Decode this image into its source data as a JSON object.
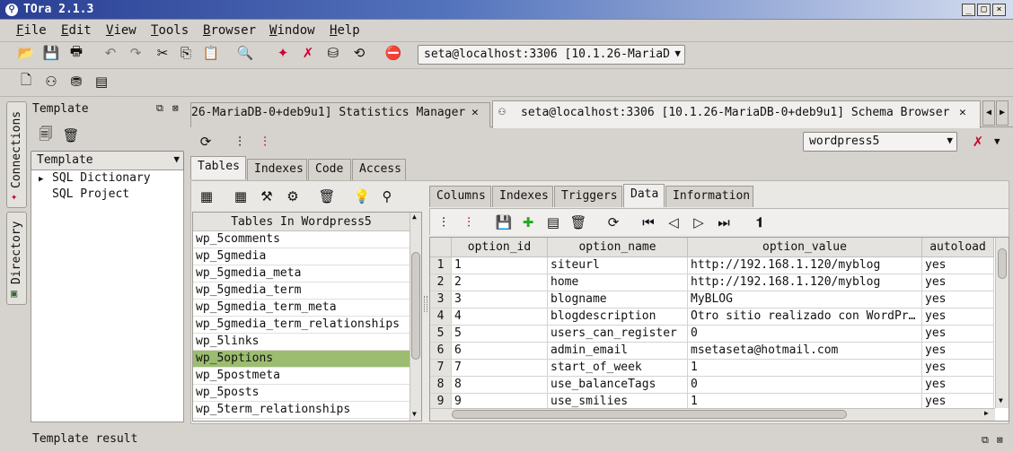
{
  "window": {
    "title": "TOra 2.1.3",
    "minimize": "_",
    "maximize": "□",
    "close": "×"
  },
  "menu": [
    {
      "pre": "",
      "u": "F",
      "post": "ile"
    },
    {
      "pre": "",
      "u": "E",
      "post": "dit"
    },
    {
      "pre": "",
      "u": "V",
      "post": "iew"
    },
    {
      "pre": "",
      "u": "T",
      "post": "ools"
    },
    {
      "pre": "",
      "u": "B",
      "post": "rowser"
    },
    {
      "pre": "",
      "u": "W",
      "post": "indow"
    },
    {
      "pre": "",
      "u": "H",
      "post": "elp"
    }
  ],
  "toolbar": {
    "connection": "seta@localhost:3306 [10.1.26-MariaD"
  },
  "side_tabs": {
    "connections": "Connections",
    "directory": "Directory"
  },
  "template_panel": {
    "title": "Template",
    "combo": "Template",
    "tree": [
      {
        "arrow": "▶",
        "label": "SQL Dictionary"
      },
      {
        "arrow": "",
        "label": "SQL Project"
      }
    ],
    "result": "Template result"
  },
  "doc_tabs": [
    {
      "label": "26-MariaDB-0+deb9u1] Statistics Manager"
    },
    {
      "label": "seta@localhost:3306 [10.1.26-MariaDB-0+deb9u1] Schema Browser"
    }
  ],
  "schema_combo": "wordpress5",
  "browser_tabs": [
    "Tables",
    "Indexes",
    "Code",
    "Access"
  ],
  "table_list": {
    "header": "Tables In Wordpress5",
    "items": [
      "wp_5comments",
      "wp_5gmedia",
      "wp_5gmedia_meta",
      "wp_5gmedia_term",
      "wp_5gmedia_term_meta",
      "wp_5gmedia_term_relationships",
      "wp_5links",
      "wp_5options",
      "wp_5postmeta",
      "wp_5posts",
      "wp_5term_relationships"
    ],
    "selected": 7
  },
  "detail_tabs": [
    "Columns",
    "Indexes",
    "Triggers",
    "Data",
    "Information"
  ],
  "grid": {
    "columns": [
      "option_id",
      "option_name",
      "option_value",
      "autoload"
    ],
    "rows": [
      {
        "n": "1",
        "id": "1",
        "name": "siteurl",
        "value": "http://192.168.1.120/myblog",
        "auto": "yes"
      },
      {
        "n": "2",
        "id": "2",
        "name": "home",
        "value": "http://192.168.1.120/myblog",
        "auto": "yes"
      },
      {
        "n": "3",
        "id": "3",
        "name": "blogname",
        "value": "MyBLOG",
        "auto": "yes"
      },
      {
        "n": "4",
        "id": "4",
        "name": "blogdescription",
        "value": "Otro sitio realizado con WordPr…",
        "auto": "yes"
      },
      {
        "n": "5",
        "id": "5",
        "name": "users_can_register",
        "value": "0",
        "auto": "yes"
      },
      {
        "n": "6",
        "id": "6",
        "name": "admin_email",
        "value": "msetaseta@hotmail.com",
        "auto": "yes"
      },
      {
        "n": "7",
        "id": "7",
        "name": "start_of_week",
        "value": "1",
        "auto": "yes"
      },
      {
        "n": "8",
        "id": "8",
        "name": "use_balanceTags",
        "value": "0",
        "auto": "yes"
      },
      {
        "n": "9",
        "id": "9",
        "name": "use_smilies",
        "value": "1",
        "auto": "yes"
      }
    ]
  },
  "colors": {
    "selected_row": "#9cbd6f",
    "title_gradient_start": "#2a3f93"
  }
}
